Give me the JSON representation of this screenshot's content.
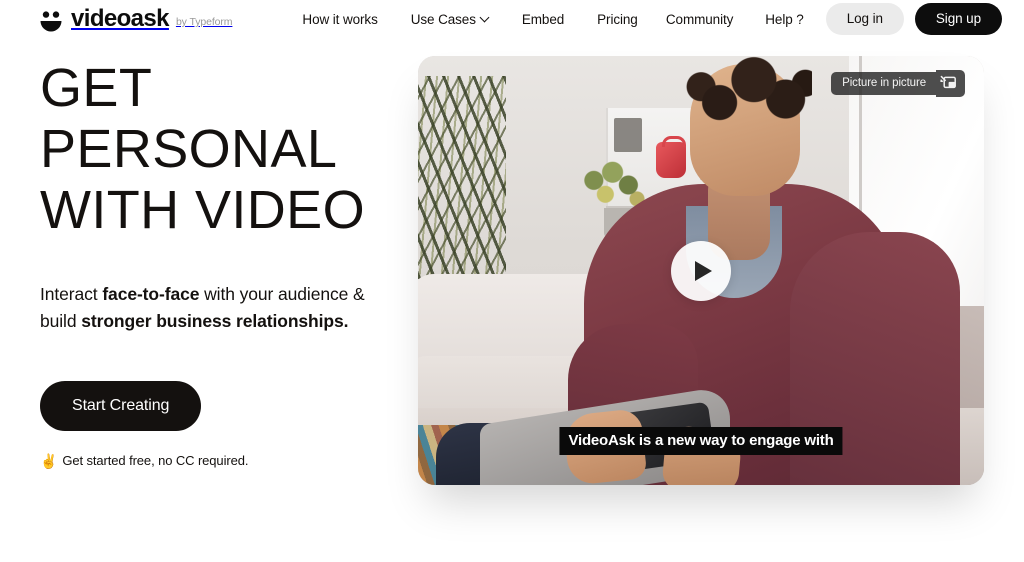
{
  "header": {
    "brand": {
      "name": "videoask",
      "byline": "by Typeform",
      "logo_icon": "smiley-face-icon"
    },
    "nav": [
      {
        "label": "How it works",
        "has_caret": false
      },
      {
        "label": "Use Cases",
        "has_caret": true,
        "caret_icon": "chevron-down-icon"
      },
      {
        "label": "Embed",
        "has_caret": false
      },
      {
        "label": "Pricing",
        "has_caret": false
      }
    ],
    "nav_right": [
      {
        "label": "Community"
      },
      {
        "label": "Help ?"
      }
    ],
    "login_label": "Log in",
    "signup_label": "Sign up",
    "login_bg": "#ebebeb",
    "signup_bg": "#0d0d0d"
  },
  "hero": {
    "headline": "GET\nPERSONAL\nWITH VIDEO",
    "subcopy": {
      "part1": "Interact ",
      "bold1": "face-to-face",
      "part2": " with your audience & build ",
      "bold2": "stronger business relationships."
    },
    "cta_label": "Start Creating",
    "note_emoji": "✌",
    "note_text": "Get started free, no CC required.",
    "cta_bg": "#14110f",
    "text_color": "#14110f"
  },
  "video": {
    "pip_tooltip": "Picture in picture",
    "pip_icon": "picture-in-picture-icon",
    "play_icon": "play-icon",
    "caption": "VideoAsk is a new way to engage with",
    "caption_bg": "#0a0a0a"
  }
}
